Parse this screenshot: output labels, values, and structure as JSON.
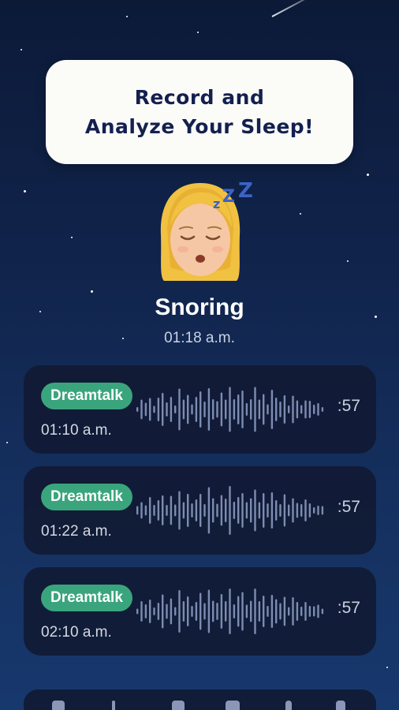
{
  "prompt": {
    "line1": "Record and",
    "line2": "Analyze Your Sleep!"
  },
  "event": {
    "avatar_icon": "sleeping-woman-icon",
    "zzz_icon": "zzz-icon",
    "title": "Snoring",
    "time": "01:18 a.m."
  },
  "recordings": [
    {
      "tag": "Dreamtalk",
      "time": "01:10 a.m.",
      "duration": ":57"
    },
    {
      "tag": "Dreamtalk",
      "time": "01:22 a.m.",
      "duration": ":57"
    },
    {
      "tag": "Dreamtalk",
      "time": "02:10 a.m.",
      "duration": ":57"
    }
  ],
  "colors": {
    "tag_green": "#3aa57c",
    "card_bg": "#111a34",
    "bubble_text": "#13204f",
    "waveform": "#7d8cb1"
  },
  "nav": {
    "icons": [
      "heart-icon",
      "stats-icon",
      "calendar-icon",
      "bag-icon",
      "person-icon",
      "profile-icon"
    ]
  }
}
